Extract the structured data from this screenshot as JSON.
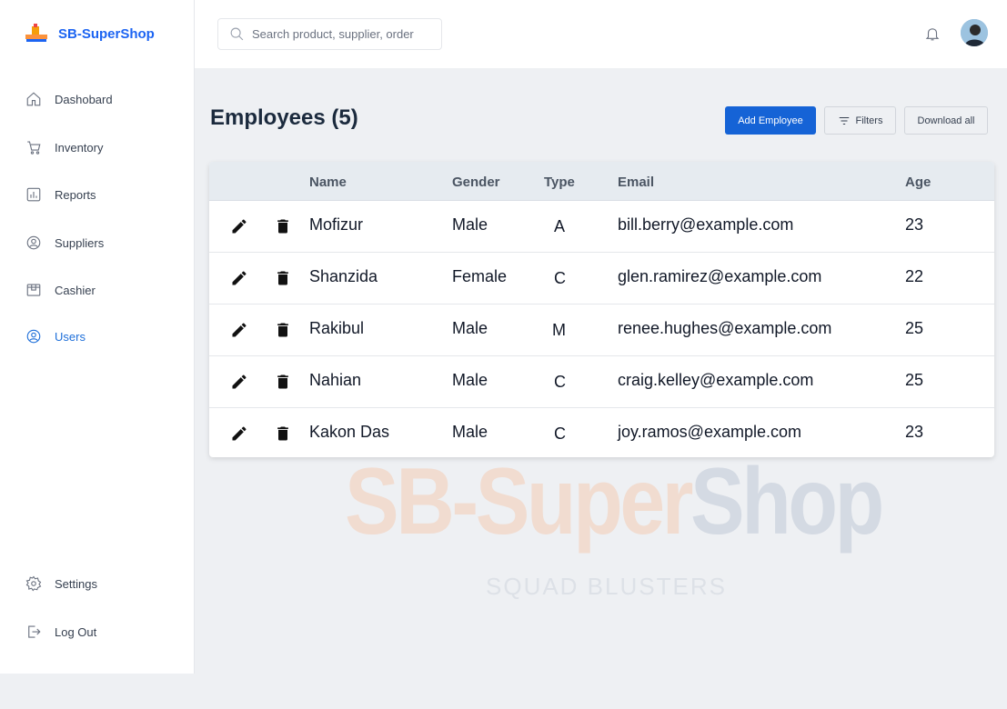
{
  "app": {
    "name": "SB-SuperShop"
  },
  "sidebar": {
    "items": [
      {
        "label": "Dashobard",
        "icon": "home-icon"
      },
      {
        "label": "Inventory",
        "icon": "cart-icon"
      },
      {
        "label": "Reports",
        "icon": "chart-icon"
      },
      {
        "label": "Suppliers",
        "icon": "user-circle-icon"
      },
      {
        "label": "Cashier",
        "icon": "box-icon"
      },
      {
        "label": "Users",
        "icon": "user-circle-icon",
        "active": true
      }
    ],
    "bottom": [
      {
        "label": "Settings",
        "icon": "gear-icon"
      },
      {
        "label": "Log Out",
        "icon": "logout-icon"
      }
    ]
  },
  "header": {
    "search_placeholder": "Search product, supplier, order"
  },
  "page": {
    "title": "Employees (5)",
    "add_label": "Add Employee",
    "filters_label": "Filters",
    "download_label": "Download all"
  },
  "table": {
    "columns": [
      "Name",
      "Gender",
      "Type",
      "Email",
      "Age"
    ],
    "rows": [
      {
        "name": "Mofizur",
        "gender": "Male",
        "type": "A",
        "email": "bill.berry@example.com",
        "age": "23"
      },
      {
        "name": "Shanzida",
        "gender": "Female",
        "type": "C",
        "email": "glen.ramirez@example.com",
        "age": "22"
      },
      {
        "name": "Rakibul",
        "gender": "Male",
        "type": "M",
        "email": "renee.hughes@example.com",
        "age": "25"
      },
      {
        "name": "Nahian",
        "gender": "Male",
        "type": "C",
        "email": "craig.kelley@example.com",
        "age": "25"
      },
      {
        "name": "Kakon Das",
        "gender": "Male",
        "type": "C",
        "email": "joy.ramos@example.com",
        "age": "23"
      }
    ]
  },
  "watermark": {
    "main_a": "SB-Super",
    "main_b": "Shop",
    "sub": "SQUAD BLUSTERS"
  },
  "colors": {
    "brand": "#1c64f2",
    "primary_button": "#1563d6",
    "active_nav": "#1e6fd9"
  }
}
